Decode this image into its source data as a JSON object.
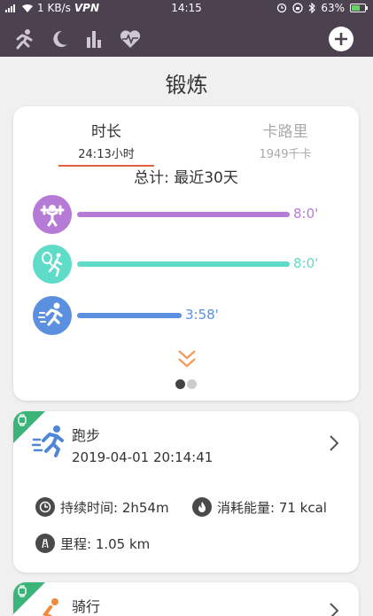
{
  "status_bar": {
    "network": "1 KB/s",
    "vpn": "VPN",
    "time": "14:15",
    "battery": "63%",
    "battery_level": 0.63
  },
  "app_bar": {
    "icons": [
      "run-icon",
      "moon-icon",
      "bar-chart-icon",
      "heart-rate-icon"
    ],
    "add_icon": "plus-icon"
  },
  "page": {
    "title": "锻炼"
  },
  "summary": {
    "tabs": [
      {
        "label": "时长",
        "value": "24:13小时",
        "active": true
      },
      {
        "label": "卡路里",
        "value": "1949千卡",
        "active": false
      }
    ],
    "total_label": "总计: 最近30天",
    "bars": [
      {
        "icon": "weightlifting-icon",
        "color": "#b57bd6",
        "value": "8:0'",
        "fraction": 0.96
      },
      {
        "icon": "tennis-icon",
        "color": "#5fdcc8",
        "value": "8:0'",
        "fraction": 0.96
      },
      {
        "icon": "running-icon",
        "color": "#5b8fe0",
        "value": "3:58'",
        "fraction": 0.47
      }
    ],
    "pager": {
      "count": 2,
      "active": 0
    }
  },
  "activities": [
    {
      "name": "跑步",
      "date": "2019-04-01 20:14:41",
      "duration_label": "持续时间: 2h54m",
      "calories_label": "消耗能量: 71 kcal",
      "distance_label": "里程: 1.05 km"
    },
    {
      "name": "骑行"
    }
  ]
}
